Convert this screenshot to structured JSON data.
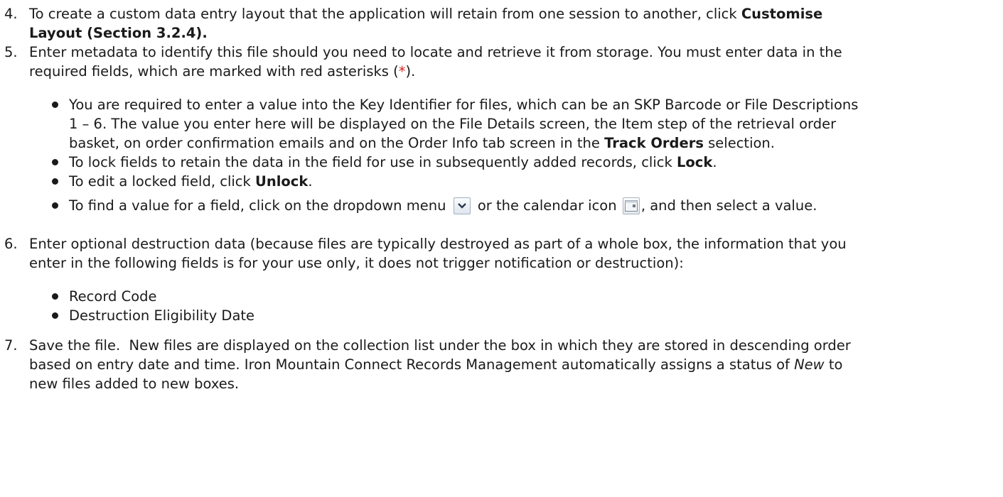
{
  "steps": [
    {
      "number": "4.",
      "lines": [
        {
          "text": "To create a custom data entry layout that the application will retain from one session to another, click ",
          "bold": "Customise"
        },
        {
          "bold": "Layout (Section 3.2.4)."
        }
      ]
    },
    {
      "number": "5.",
      "line1": "Enter metadata to identify this file should you need to locate and retrieve it from storage. You must enter data in the",
      "line2_a": "required fields, which are marked with red asterisks (",
      "line2_red": "*",
      "line2_b": ").",
      "bullets": [
        {
          "l1": "You are required to enter a value into the Key Identifier for files, which can be an SKP Barcode or File Descriptions",
          "l2": "1 – 6. The value you enter here will be displayed on the File Details screen, the Item step of the retrieval order",
          "l3_a": "basket, on order confirmation emails and on the Order Info tab screen in the ",
          "l3_bold": "Track Orders",
          "l3_b": " selection."
        },
        {
          "a": "To lock fields to retain the data in the field for use in subsequently added records, click ",
          "bold": "Lock",
          "b": "."
        },
        {
          "a": "To edit a locked field, click ",
          "bold": "Unlock",
          "b": "."
        },
        {
          "a": "To find a value for a field, click on the dropdown menu ",
          "mid": " or the calendar icon ",
          "b": ", and then select a value.",
          "icons": [
            "chevron-down-icon",
            "calendar-icon"
          ]
        }
      ]
    },
    {
      "number": "6.",
      "line1": "Enter optional destruction data (because files are typically destroyed as part of a whole box, the information that you",
      "line2": "enter in the following fields is for your use only, it does not trigger notification or destruction):",
      "bullets": [
        "Record Code",
        "Destruction Eligibility Date"
      ]
    },
    {
      "number": "7.",
      "line1": "Save the file.  New files are displayed on the collection list under the box in which they are stored in descending order",
      "line2_a": "based on entry date and time. Iron Mountain Connect Records Management automatically assigns a status of ",
      "line2_italic": "New",
      "line2_b": " to",
      "line3": "new files added to new boxes."
    }
  ],
  "colors": {
    "text": "#1a1a1a",
    "asterisk": "#e02020",
    "background": "#ffffff"
  }
}
